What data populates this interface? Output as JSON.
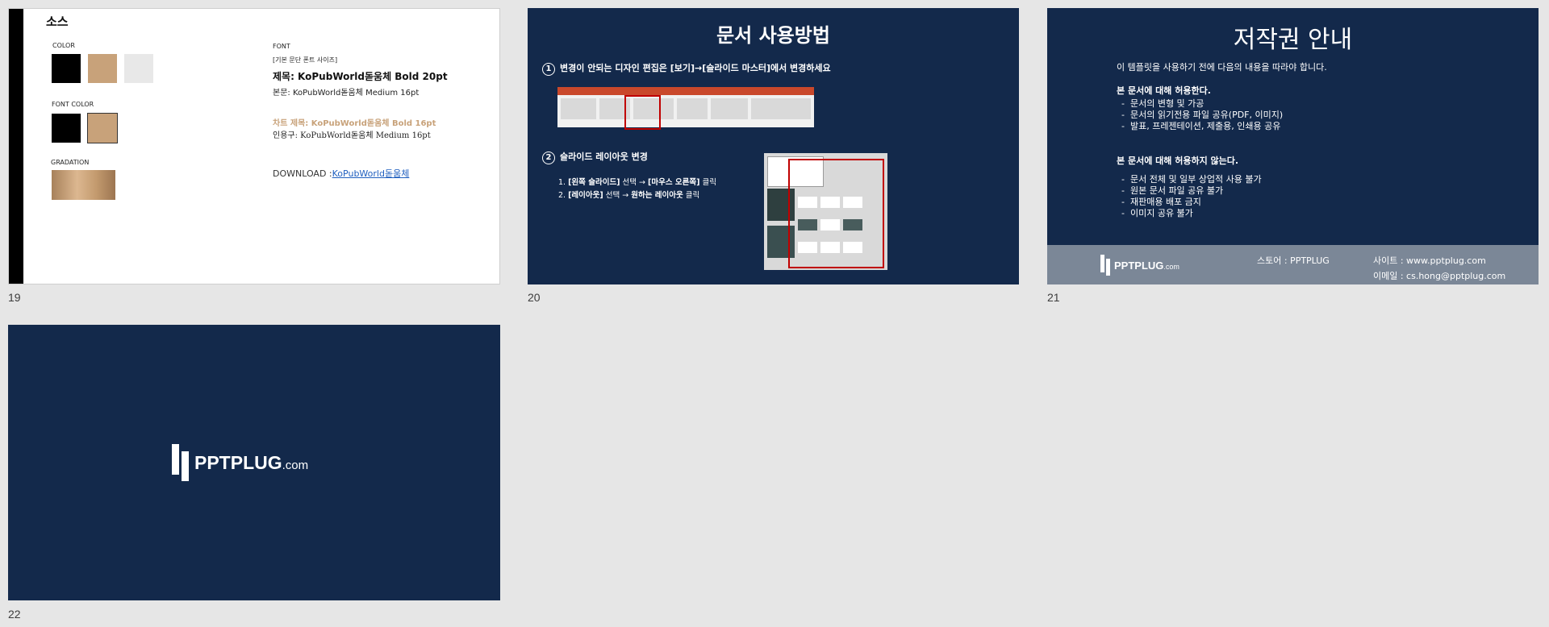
{
  "slides": [
    {
      "number": "19",
      "title": "소스",
      "color_label": "COLOR",
      "font_color_label": "FONT COLOR",
      "gradation_label": "GRADATION",
      "font_label": "FONT",
      "font_sub": "[기본 문단 폰트 사이즈]",
      "title_font": "제목: KoPubWorld돋움체 Bold 20pt",
      "body_font": "본문: KoPubWorld돋움체 Medium 16pt",
      "chart_font": "차트 제목: KoPubWorld돋움체 Bold 16pt",
      "quote_font": "인용구: KoPubWorld돋움체 Medium 16pt",
      "download_label": "DOWNLOAD :",
      "download_link": "KoPubWorld돋움체",
      "colors": {
        "black": "#000000",
        "tan": "#c8a27a",
        "light": "#e8e8e8",
        "accent_text": "#c8a27a"
      }
    },
    {
      "number": "20",
      "title": "문서 사용방법",
      "step1_num": "1",
      "step1": "변경이 안되는 디자인 편집은 [보기]→[슬라이드 마스터]에서 변경하세요",
      "step2_num": "2",
      "step2": "슬라이드 레이아웃 변경",
      "sub1_a": "1. ",
      "sub1_b": "[왼쪽 슬라이드]",
      "sub1_c": " 선택 → ",
      "sub1_d": "[마우스 오른쪽]",
      "sub1_e": " 클릭",
      "sub2_a": "2. ",
      "sub2_b": "[레이아웃]",
      "sub2_c": " 선택 → ",
      "sub2_d": "원하는 레이아웃",
      "sub2_e": " 클릭"
    },
    {
      "number": "21",
      "title": "저작권 안내",
      "intro": "이 템플릿을 사용하기 전에 다음의 내용을 따라야 합니다.",
      "allowed_heading": "본 문서에 대해 허용한다.",
      "allowed": [
        "문서의 변형 및 가공",
        "문서의 읽기전용 파일 공유(PDF, 이미지)",
        "발표, 프레젠테이션, 제출용, 인쇄용 공유"
      ],
      "denied_heading": "본 문서에 대해 허용하지 않는다.",
      "denied": [
        "문서 전체 및 일부 상업적 사용 불가",
        "원본 문서 파일 공유 불가",
        "재판매용 배포 금지",
        "이미지 공유 불가"
      ],
      "store": "스토어 : PPTPLUG",
      "site": "사이트 : www.pptplug.com",
      "email": "이메일 :  cs.hong@pptplug.com",
      "logo_word": "PPTPLUG",
      "logo_dotcom": ".com"
    },
    {
      "number": "22",
      "logo_word": "PPTPLUG",
      "logo_dotcom": ".com"
    }
  ],
  "theme": {
    "navy": "#13294b",
    "workspace": "#e6e6e6",
    "footer_gray": "#7b8797",
    "highlight_red": "#c00000"
  }
}
